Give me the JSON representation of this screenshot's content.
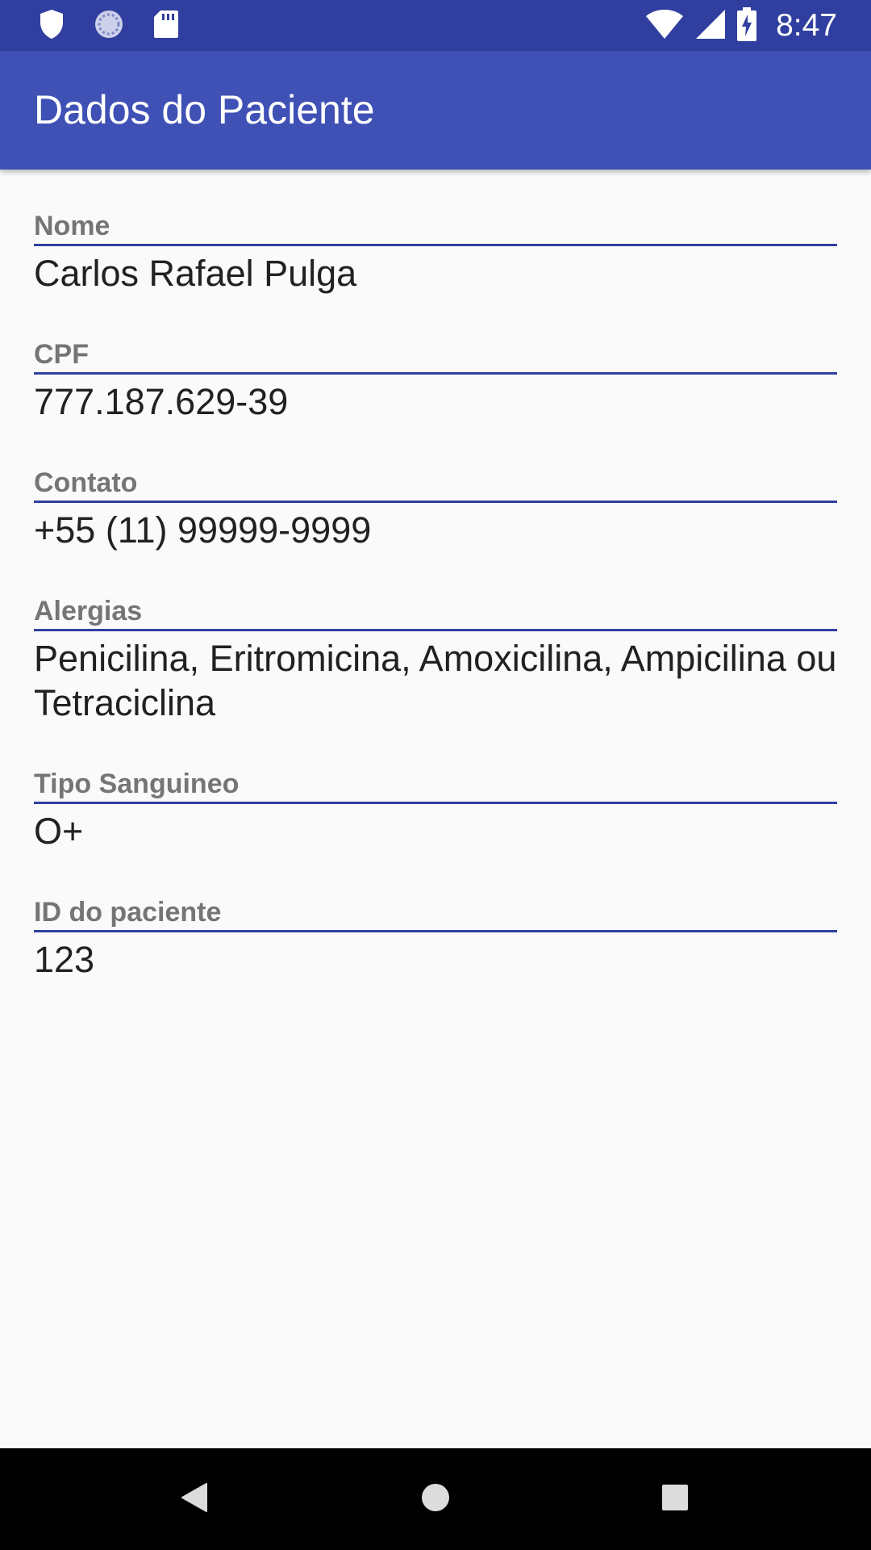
{
  "status_bar": {
    "time": "8:47",
    "left_icons": [
      "shield-icon",
      "sync-icon",
      "sd-card-icon"
    ],
    "right_icons": [
      "wifi-icon",
      "signal-icon",
      "battery-charging-icon"
    ]
  },
  "app_bar": {
    "title": "Dados do Paciente"
  },
  "fields": [
    {
      "label": "Nome",
      "value": "Carlos Rafael Pulga"
    },
    {
      "label": "CPF",
      "value": "777.187.629-39"
    },
    {
      "label": "Contato",
      "value": "+55 (11) 99999-9999"
    },
    {
      "label": "Alergias",
      "value": "Penicilina, Eritromicina, Amoxicilina, Ampicilina ou Tetraciclina"
    },
    {
      "label": "Tipo Sanguineo",
      "value": "O+"
    },
    {
      "label": "ID do paciente",
      "value": "123"
    }
  ],
  "nav_bar": {
    "buttons": [
      "back-icon",
      "home-icon",
      "recents-icon"
    ]
  },
  "colors": {
    "status_bar": "#303f9f",
    "app_bar": "#3f51b5",
    "underline": "#303f9f",
    "label_text": "#757575",
    "value_text": "#212121",
    "background": "#fafafa",
    "nav_bar": "#000000"
  }
}
